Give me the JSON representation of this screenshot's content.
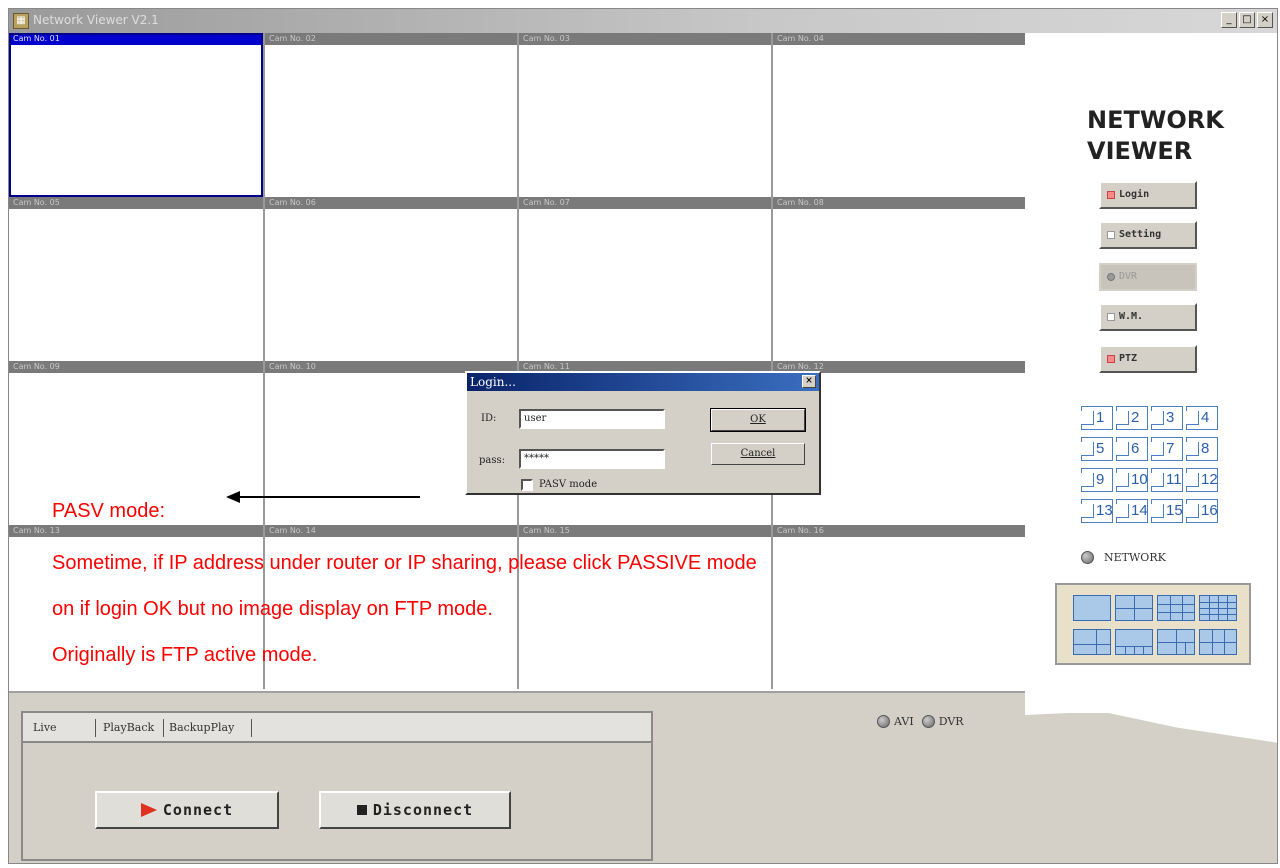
{
  "window": {
    "title": "Network Viewer V2.1",
    "icon_label": "▦",
    "minimize": "_",
    "maximize": "□",
    "close": "×"
  },
  "cameras": [
    {
      "label": "Cam No. 01",
      "selected": true
    },
    {
      "label": "Cam No. 02"
    },
    {
      "label": "Cam No. 03"
    },
    {
      "label": "Cam No. 04"
    },
    {
      "label": "Cam No. 05"
    },
    {
      "label": "Cam No. 06"
    },
    {
      "label": "Cam No. 07"
    },
    {
      "label": "Cam No. 08"
    },
    {
      "label": "Cam No. 09"
    },
    {
      "label": "Cam No. 10"
    },
    {
      "label": "Cam No. 11"
    },
    {
      "label": "Cam No. 12"
    },
    {
      "label": "Cam No. 13"
    },
    {
      "label": "Cam No. 14"
    },
    {
      "label": "Cam No. 15"
    },
    {
      "label": "Cam No. 16"
    }
  ],
  "sidebar": {
    "brand_line1": "NETWORK",
    "brand_line2": "VIEWER",
    "buttons": [
      {
        "label": "Login",
        "name": "login-button",
        "enabled": true
      },
      {
        "label": "Setting",
        "name": "setting-button",
        "enabled": true
      },
      {
        "label": "DVR",
        "name": "dvr-button",
        "enabled": false
      },
      {
        "label": "W.M.",
        "name": "wm-button",
        "enabled": true
      },
      {
        "label": "PTZ",
        "name": "ptz-button",
        "enabled": true
      }
    ],
    "channels": [
      "1",
      "2",
      "3",
      "4",
      "5",
      "6",
      "7",
      "8",
      "9",
      "10",
      "11",
      "12",
      "13",
      "14",
      "15",
      "16"
    ],
    "network_label": "NETWORK"
  },
  "bottom": {
    "tabs": [
      "Live",
      "PlayBack",
      "BackupPlay"
    ],
    "active_tab": "Live",
    "connect_label": "Connect",
    "disconnect_label": "Disconnect",
    "avi_label": "AVI",
    "dvr_label": "DVR"
  },
  "login_dialog": {
    "title": "Login...",
    "close": "×",
    "id_label": "ID:",
    "id_value": "user",
    "pass_label": "pass:",
    "pass_value": "*****",
    "pasv_label": "PASV mode",
    "ok_label": "OK",
    "cancel_label": "Cancel"
  },
  "annotation": {
    "heading": "PASV mode:",
    "line1": "Sometime, if IP address under router or IP sharing, please click PASSIVE mode",
    "line2": "on if login OK but no image display on FTP mode.",
    "line3": "Originally is FTP active mode.",
    "color": "#ff0000"
  }
}
